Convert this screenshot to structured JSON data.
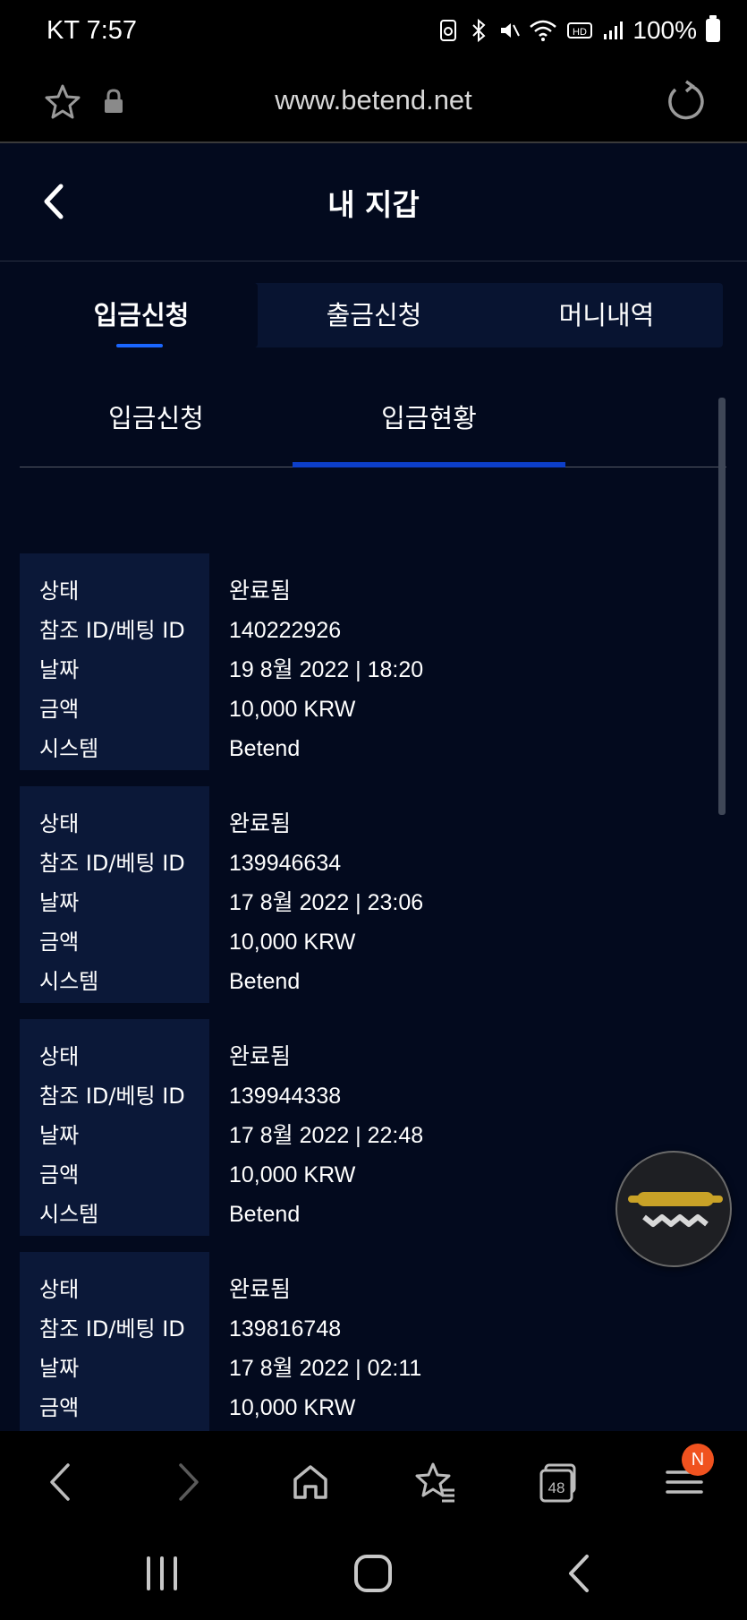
{
  "status_bar": {
    "carrier_time": "KT 7:57",
    "battery": "100%"
  },
  "browser": {
    "url": "www.betend.net",
    "tab_count": "48",
    "notification_badge": "N"
  },
  "header": {
    "title": "내 지갑"
  },
  "tabs": [
    {
      "label": "입금신청",
      "active": true
    },
    {
      "label": "출금신청",
      "active": false
    },
    {
      "label": "머니내역",
      "active": false
    }
  ],
  "subtabs": [
    {
      "label": "입금신청",
      "active": false
    },
    {
      "label": "입금현황",
      "active": true
    }
  ],
  "field_labels": {
    "status": "상태",
    "reference": "참조 ID/베팅 ID",
    "date": "날짜",
    "amount": "금액",
    "system": "시스템"
  },
  "records": [
    {
      "status": "완료됨",
      "reference": "140222926",
      "date": "19 8월 2022 | 18:20",
      "amount": "10,000 KRW",
      "system": "Betend"
    },
    {
      "status": "완료됨",
      "reference": "139946634",
      "date": "17 8월 2022 | 23:06",
      "amount": "10,000 KRW",
      "system": "Betend"
    },
    {
      "status": "완료됨",
      "reference": "139944338",
      "date": "17 8월 2022 | 22:48",
      "amount": "10,000 KRW",
      "system": "Betend"
    },
    {
      "status": "완료됨",
      "reference": "139816748",
      "date": "17 8월 2022 | 02:11",
      "amount": "10,000 KRW",
      "system": ""
    }
  ],
  "colors": {
    "background": "#030a1e",
    "tab_bar": "#081431",
    "label_cell": "#0b1838",
    "accent_blue": "#1a66ff",
    "subtab_underline": "#0d3fc9",
    "fab_gold": "#c9a227",
    "badge": "#f0521f"
  },
  "icons": [
    "star-icon",
    "lock-icon",
    "refresh-icon",
    "back-arrow-icon",
    "chat-support-icon",
    "nav-back-icon",
    "nav-forward-icon",
    "home-icon",
    "bookmarks-icon",
    "tabs-icon",
    "menu-icon",
    "recents-icon",
    "home-circle-icon",
    "system-back-icon"
  ]
}
